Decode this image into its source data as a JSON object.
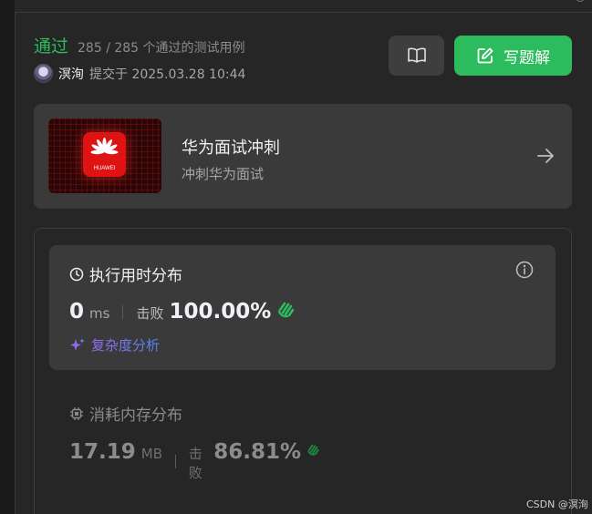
{
  "result": {
    "status": "通过",
    "testcases": "285 / 285 个通过的测试用例",
    "username": "溟洵",
    "submitted": "提交于 2025.03.28 10:44"
  },
  "buttons": {
    "solution_label": "写题解",
    "book_icon": "book-open-icon",
    "edit_icon": "edit-note-icon"
  },
  "promo": {
    "title": "华为面试冲刺",
    "subtitle": "冲刺华为面试",
    "logo_text": "HUAWEI"
  },
  "runtime": {
    "title": "执行用时分布",
    "value": "0",
    "unit": "ms",
    "beat_label": "击败",
    "beat_pct": "100.00%",
    "analysis_label": "复杂度分析"
  },
  "memory": {
    "title": "消耗内存分布",
    "value": "17.19",
    "unit": "MB",
    "beat_label": "击败",
    "beat_pct": "86.81%"
  },
  "watermark": "CSDN @溟洵",
  "colors": {
    "accent_green": "#2cbb5d",
    "panel_bg": "#262626",
    "card_bg": "#3a3a3a",
    "huawei_red": "#e01313"
  }
}
